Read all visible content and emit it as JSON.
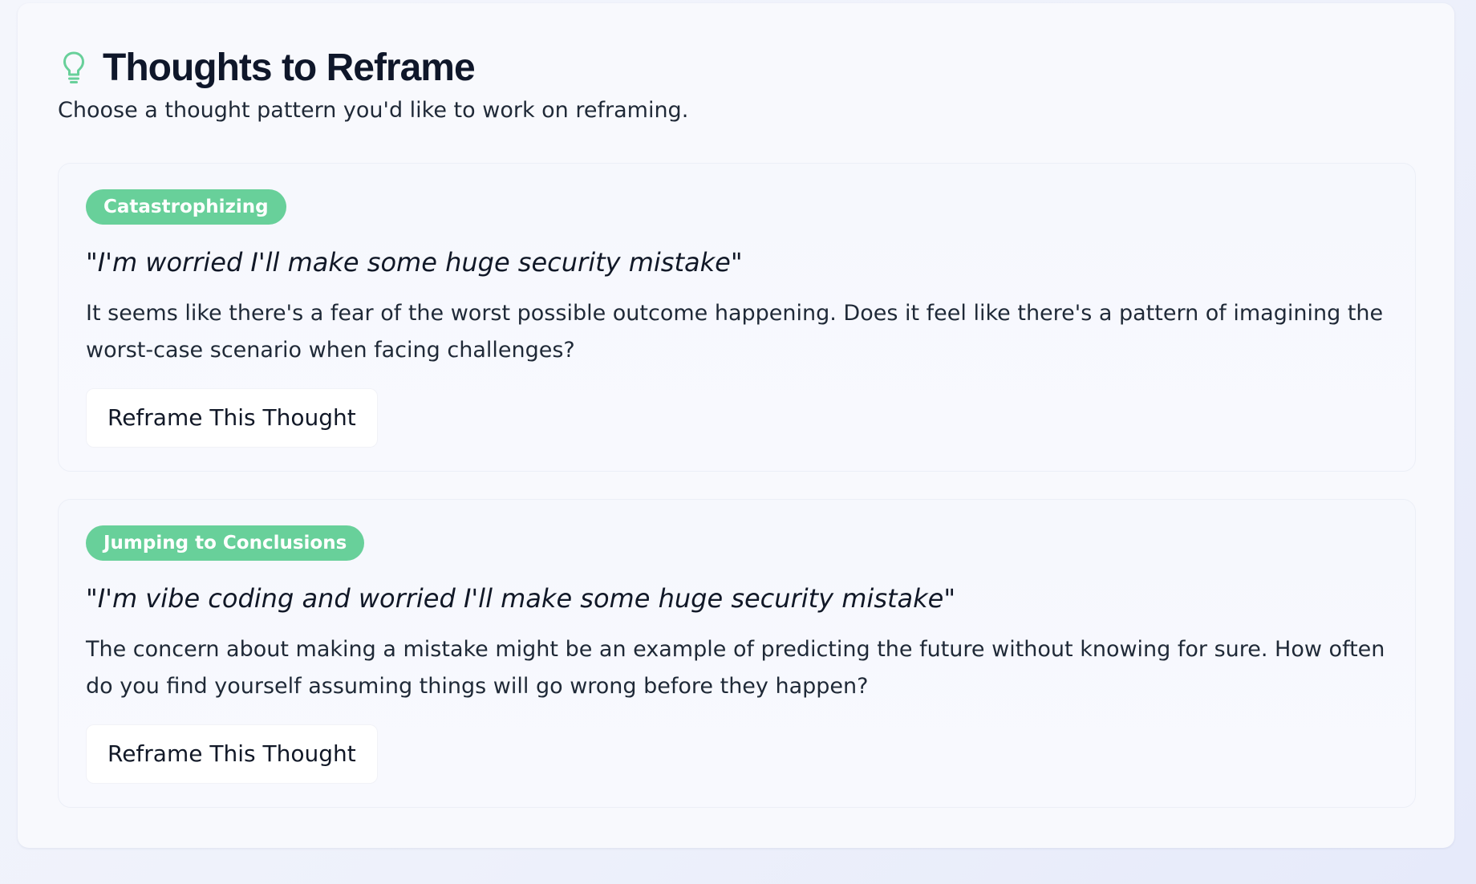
{
  "header": {
    "icon": "lightbulb-icon",
    "title": "Thoughts to Reframe",
    "subtitle": "Choose a thought pattern you'd like to work on reframing."
  },
  "colors": {
    "accent": "#68d09a",
    "title": "#0f172a"
  },
  "cards": [
    {
      "tag": "Catastrophizing",
      "quote": "\"I'm worried I'll make some huge security mistake\"",
      "description": "It seems like there's a fear of the worst possible outcome happening. Does it feel like there's a pattern of imagining the worst-case scenario when facing challenges?",
      "button_label": "Reframe This Thought"
    },
    {
      "tag": "Jumping to Conclusions",
      "quote": "\"I'm vibe coding and worried I'll make some huge security mistake\"",
      "description": "The concern about making a mistake might be an example of predicting the future without knowing for sure. How often do you find yourself assuming things will go wrong before they happen?",
      "button_label": "Reframe This Thought"
    }
  ]
}
